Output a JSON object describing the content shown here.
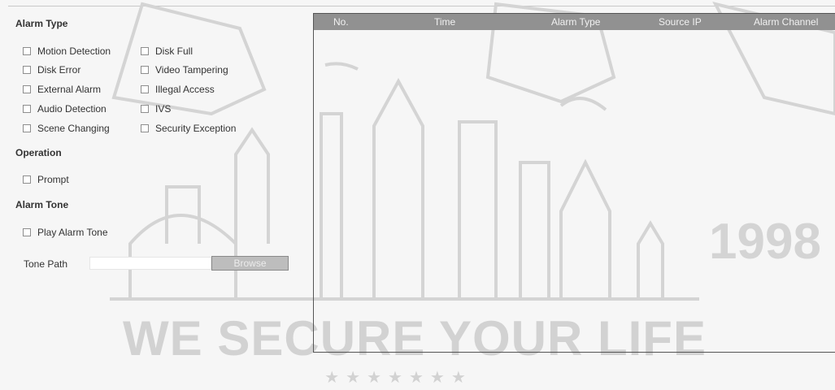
{
  "alarm_type": {
    "title": "Alarm Type",
    "options": [
      {
        "label": "Motion Detection",
        "checked": false
      },
      {
        "label": "Disk Full",
        "checked": false
      },
      {
        "label": "Disk Error",
        "checked": false
      },
      {
        "label": "Video Tampering",
        "checked": false
      },
      {
        "label": "External Alarm",
        "checked": false
      },
      {
        "label": "Illegal Access",
        "checked": false
      },
      {
        "label": "Audio Detection",
        "checked": false
      },
      {
        "label": "IVS",
        "checked": false
      },
      {
        "label": "Scene Changing",
        "checked": false
      },
      {
        "label": "Security Exception",
        "checked": false
      }
    ]
  },
  "operation": {
    "title": "Operation",
    "prompt": {
      "label": "Prompt",
      "checked": false
    }
  },
  "alarm_tone": {
    "title": "Alarm Tone",
    "play": {
      "label": "Play Alarm Tone",
      "checked": false
    },
    "path_label": "Tone Path",
    "path_value": "",
    "browse_label": "Browse"
  },
  "table": {
    "columns": [
      "No.",
      "Time",
      "Alarm Type",
      "Source IP",
      "Alarm Channel"
    ],
    "rows": []
  },
  "watermark": {
    "slogan": "WE SECURE YOUR LIFE",
    "year": "1998",
    "stars": "★★★★★★★"
  }
}
